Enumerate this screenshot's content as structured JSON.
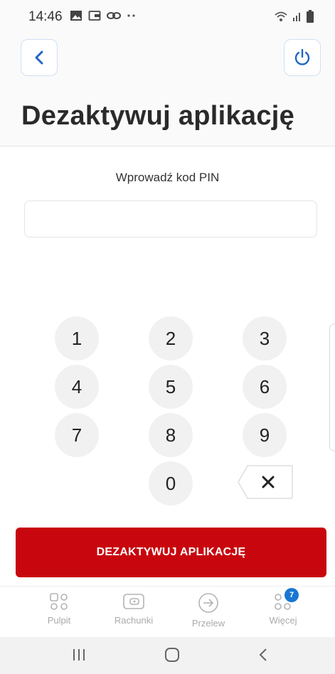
{
  "status": {
    "time": "14:46"
  },
  "header": {
    "title": "Dezaktywuj aplikację"
  },
  "pin": {
    "label": "Wprowadź kod PIN",
    "value": "",
    "placeholder": ""
  },
  "keypad": {
    "k1": "1",
    "k2": "2",
    "k3": "3",
    "k4": "4",
    "k5": "5",
    "k6": "6",
    "k7": "7",
    "k8": "8",
    "k9": "9",
    "k0": "0"
  },
  "cta": {
    "label": "DEZAKTYWUJ APLIKACJĘ"
  },
  "nav": {
    "pulpit": "Pulpit",
    "rachunki": "Rachunki",
    "przelew": "Przelew",
    "wiecej": "Więcej",
    "wiecej_badge": "7"
  },
  "colors": {
    "accent": "#c8060e",
    "link": "#1976d2",
    "badge": "#1976d2"
  },
  "icons": [
    "back-chevron-icon",
    "power-icon",
    "backspace-icon",
    "dashboard-icon",
    "wallet-icon",
    "transfer-arrow-icon",
    "more-icon"
  ]
}
